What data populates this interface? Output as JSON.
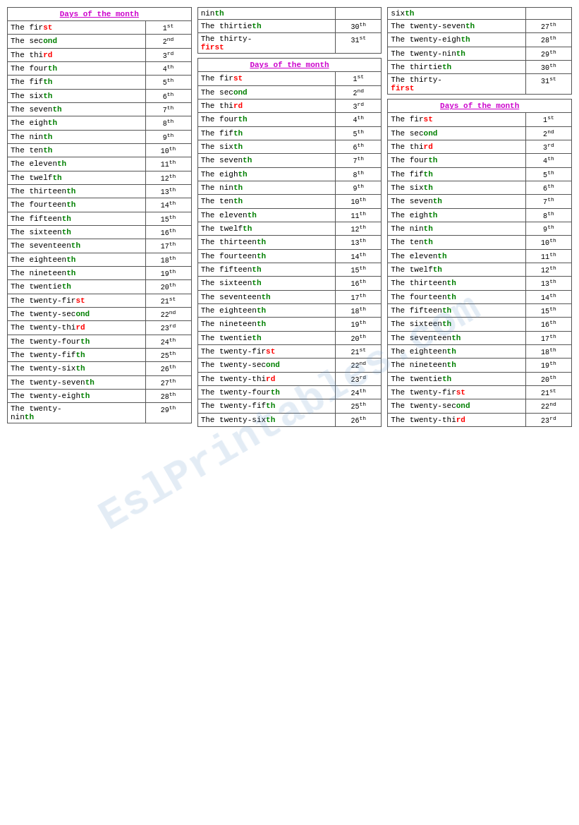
{
  "columns": [
    {
      "tables": [
        {
          "title": "Days of the month",
          "rows": [
            [
              "The fir",
              "st",
              "1",
              "st"
            ],
            [
              "The sec",
              "ond",
              "2",
              "nd"
            ],
            [
              "The thi",
              "rd",
              "3",
              "rd"
            ],
            [
              "The four",
              "th",
              "4",
              "th"
            ],
            [
              "The fif",
              "th",
              "5",
              "th"
            ],
            [
              "The six",
              "th",
              "6",
              "th"
            ],
            [
              "The seven",
              "th",
              "7",
              "th"
            ],
            [
              "The eigh",
              "th",
              "8",
              "th"
            ],
            [
              "The nin",
              "th",
              "9",
              "th"
            ],
            [
              "The ten",
              "th",
              "10",
              "th"
            ],
            [
              "The eleven",
              "th",
              "11",
              "th"
            ],
            [
              "The twelf",
              "th",
              "12",
              "th"
            ],
            [
              "The thirteen",
              "th",
              "13",
              "th"
            ],
            [
              "The fourteen",
              "th",
              "14",
              "th"
            ],
            [
              "The fifteen",
              "th",
              "15",
              "th"
            ],
            [
              "The sixteen",
              "th",
              "16",
              "th"
            ],
            [
              "The seventeen",
              "th",
              "17",
              "th"
            ],
            [
              "The eighteen",
              "th",
              "18",
              "th"
            ],
            [
              "The nineteen",
              "th",
              "19",
              "th"
            ],
            [
              "The twentie",
              "th",
              "20",
              "th"
            ],
            [
              "The twenty-fir",
              "st",
              "21",
              "st"
            ],
            [
              "The twenty-sec",
              "ond",
              "22",
              "nd"
            ],
            [
              "The twenty-thi",
              "rd",
              "23",
              "rd"
            ],
            [
              "The twenty-four",
              "th",
              "24",
              "th"
            ],
            [
              "The twenty-fif",
              "th",
              "25",
              "th"
            ],
            [
              "The twenty-six",
              "th",
              "26",
              "th"
            ],
            [
              "The twenty-seven",
              "th",
              "27",
              "th"
            ],
            [
              "The twenty-eigh",
              "th",
              "28",
              "th"
            ],
            [
              "The twenty-",
              "th",
              "29",
              "th"
            ]
          ]
        }
      ]
    },
    {
      "tables": [
        {
          "title": null,
          "topRows": [
            [
              "nin",
              "th",
              "",
              ""
            ],
            [
              "The thirtie",
              "th",
              "30",
              "th"
            ],
            [
              "The thirty-fir",
              "st",
              "31",
              "st"
            ]
          ]
        },
        {
          "title": "Days of the month",
          "rows": [
            [
              "The fir",
              "st",
              "1",
              "st"
            ],
            [
              "The sec",
              "ond",
              "2",
              "nd"
            ],
            [
              "The thi",
              "rd",
              "3",
              "rd"
            ],
            [
              "The four",
              "th",
              "4",
              "th"
            ],
            [
              "The fif",
              "th",
              "5",
              "th"
            ],
            [
              "The six",
              "th",
              "6",
              "th"
            ],
            [
              "The seven",
              "th",
              "7",
              "th"
            ],
            [
              "The eigh",
              "th",
              "8",
              "th"
            ],
            [
              "The nin",
              "th",
              "9",
              "th"
            ],
            [
              "The ten",
              "th",
              "10",
              "th"
            ],
            [
              "The eleven",
              "th",
              "11",
              "th"
            ],
            [
              "The twelf",
              "th",
              "12",
              "th"
            ],
            [
              "The thirteen",
              "th",
              "13",
              "th"
            ],
            [
              "The fourteen",
              "th",
              "14",
              "th"
            ],
            [
              "The fifteen",
              "th",
              "15",
              "th"
            ],
            [
              "The sixteen",
              "th",
              "16",
              "th"
            ],
            [
              "The seventeen",
              "th",
              "17",
              "th"
            ],
            [
              "The eighteen",
              "th",
              "18",
              "th"
            ],
            [
              "The nineteen",
              "th",
              "19",
              "th"
            ],
            [
              "The twentie",
              "th",
              "20",
              "th"
            ],
            [
              "The twenty-fir",
              "st",
              "21",
              "st"
            ],
            [
              "The twenty-sec",
              "ond",
              "22",
              "nd"
            ],
            [
              "The twenty-thi",
              "rd",
              "23",
              "rd"
            ],
            [
              "The twenty-four",
              "th",
              "24",
              "th"
            ],
            [
              "The twenty-fif",
              "th",
              "25",
              "th"
            ],
            [
              "The twenty-six",
              "th",
              "26",
              "th"
            ]
          ]
        }
      ]
    },
    {
      "tables": [
        {
          "title": null,
          "topRows": [
            [
              "six",
              "th",
              "",
              ""
            ],
            [
              "The twenty-seven",
              "th",
              "27",
              "th"
            ],
            [
              "The twenty-eigh",
              "th",
              "28",
              "th"
            ],
            [
              "The twenty-nin",
              "th",
              "29",
              "th"
            ],
            [
              "The thirtie",
              "th",
              "30",
              "th"
            ],
            [
              "The thirty-fir",
              "st",
              "31",
              "st"
            ]
          ]
        },
        {
          "title": "Days of the month",
          "rows": [
            [
              "The fir",
              "st",
              "1",
              "st"
            ],
            [
              "The sec",
              "ond",
              "2",
              "nd"
            ],
            [
              "The thi",
              "rd",
              "3",
              "rd"
            ],
            [
              "The four",
              "th",
              "4",
              "th"
            ],
            [
              "The fif",
              "th",
              "5",
              "th"
            ],
            [
              "The six",
              "th",
              "6",
              "th"
            ],
            [
              "The seven",
              "th",
              "7",
              "th"
            ],
            [
              "The eigh",
              "th",
              "8",
              "th"
            ],
            [
              "The nin",
              "th",
              "9",
              "th"
            ],
            [
              "The ten",
              "th",
              "10",
              "th"
            ],
            [
              "The eleven",
              "th",
              "11",
              "th"
            ],
            [
              "The twelf",
              "th",
              "12",
              "th"
            ],
            [
              "The thirteen",
              "th",
              "13",
              "th"
            ],
            [
              "The fourteen",
              "th",
              "14",
              "th"
            ],
            [
              "The fifteen",
              "th",
              "15",
              "th"
            ],
            [
              "The sixteen",
              "th",
              "16",
              "th"
            ],
            [
              "The seventeen",
              "th",
              "17",
              "th"
            ],
            [
              "The eighteen",
              "th",
              "18",
              "th"
            ],
            [
              "The nineteen",
              "th",
              "19",
              "th"
            ],
            [
              "The twentie",
              "th",
              "20",
              "th"
            ],
            [
              "The twenty-fir",
              "st",
              "21",
              "st"
            ],
            [
              "The twenty-sec",
              "ond",
              "22",
              "nd"
            ],
            [
              "The twenty-thi",
              "rd",
              "23",
              "rd"
            ]
          ]
        }
      ]
    }
  ],
  "watermark": "EslPrintables.com"
}
